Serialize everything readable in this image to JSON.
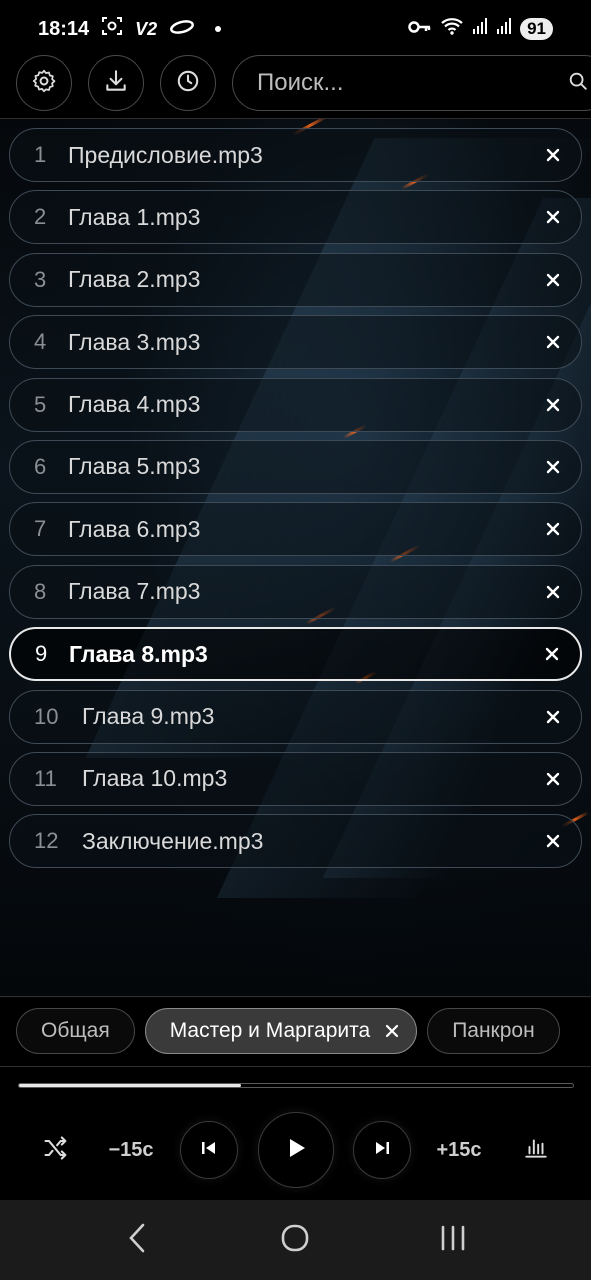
{
  "status_bar": {
    "time": "18:14",
    "carrier_label": "V2",
    "battery": "91"
  },
  "search": {
    "placeholder": "Поиск..."
  },
  "playlist": {
    "tracks": [
      {
        "num": "1",
        "title": "Предисловие.mp3"
      },
      {
        "num": "2",
        "title": "Глава 1.mp3"
      },
      {
        "num": "3",
        "title": "Глава 2.mp3"
      },
      {
        "num": "4",
        "title": "Глава 3.mp3"
      },
      {
        "num": "5",
        "title": "Глава 4.mp3"
      },
      {
        "num": "6",
        "title": "Глава 5.mp3"
      },
      {
        "num": "7",
        "title": "Глава 6.mp3"
      },
      {
        "num": "8",
        "title": "Глава 7.mp3"
      },
      {
        "num": "9",
        "title": "Глава 8.mp3"
      },
      {
        "num": "10",
        "title": "Глава 9.mp3"
      },
      {
        "num": "11",
        "title": "Глава 10.mp3"
      },
      {
        "num": "12",
        "title": "Заключение.mp3"
      }
    ],
    "active_index": 8
  },
  "tabs": [
    {
      "label": "Общая"
    },
    {
      "label": "Мастер и Маргарита"
    },
    {
      "label": "Панкрон"
    }
  ],
  "player": {
    "progress": 0.4,
    "rewind_label": "−15с",
    "forward_label": "+15с"
  },
  "colors": {
    "accent": "#e8e8e8",
    "background": "#000000",
    "streak": "#ff6a1a"
  }
}
